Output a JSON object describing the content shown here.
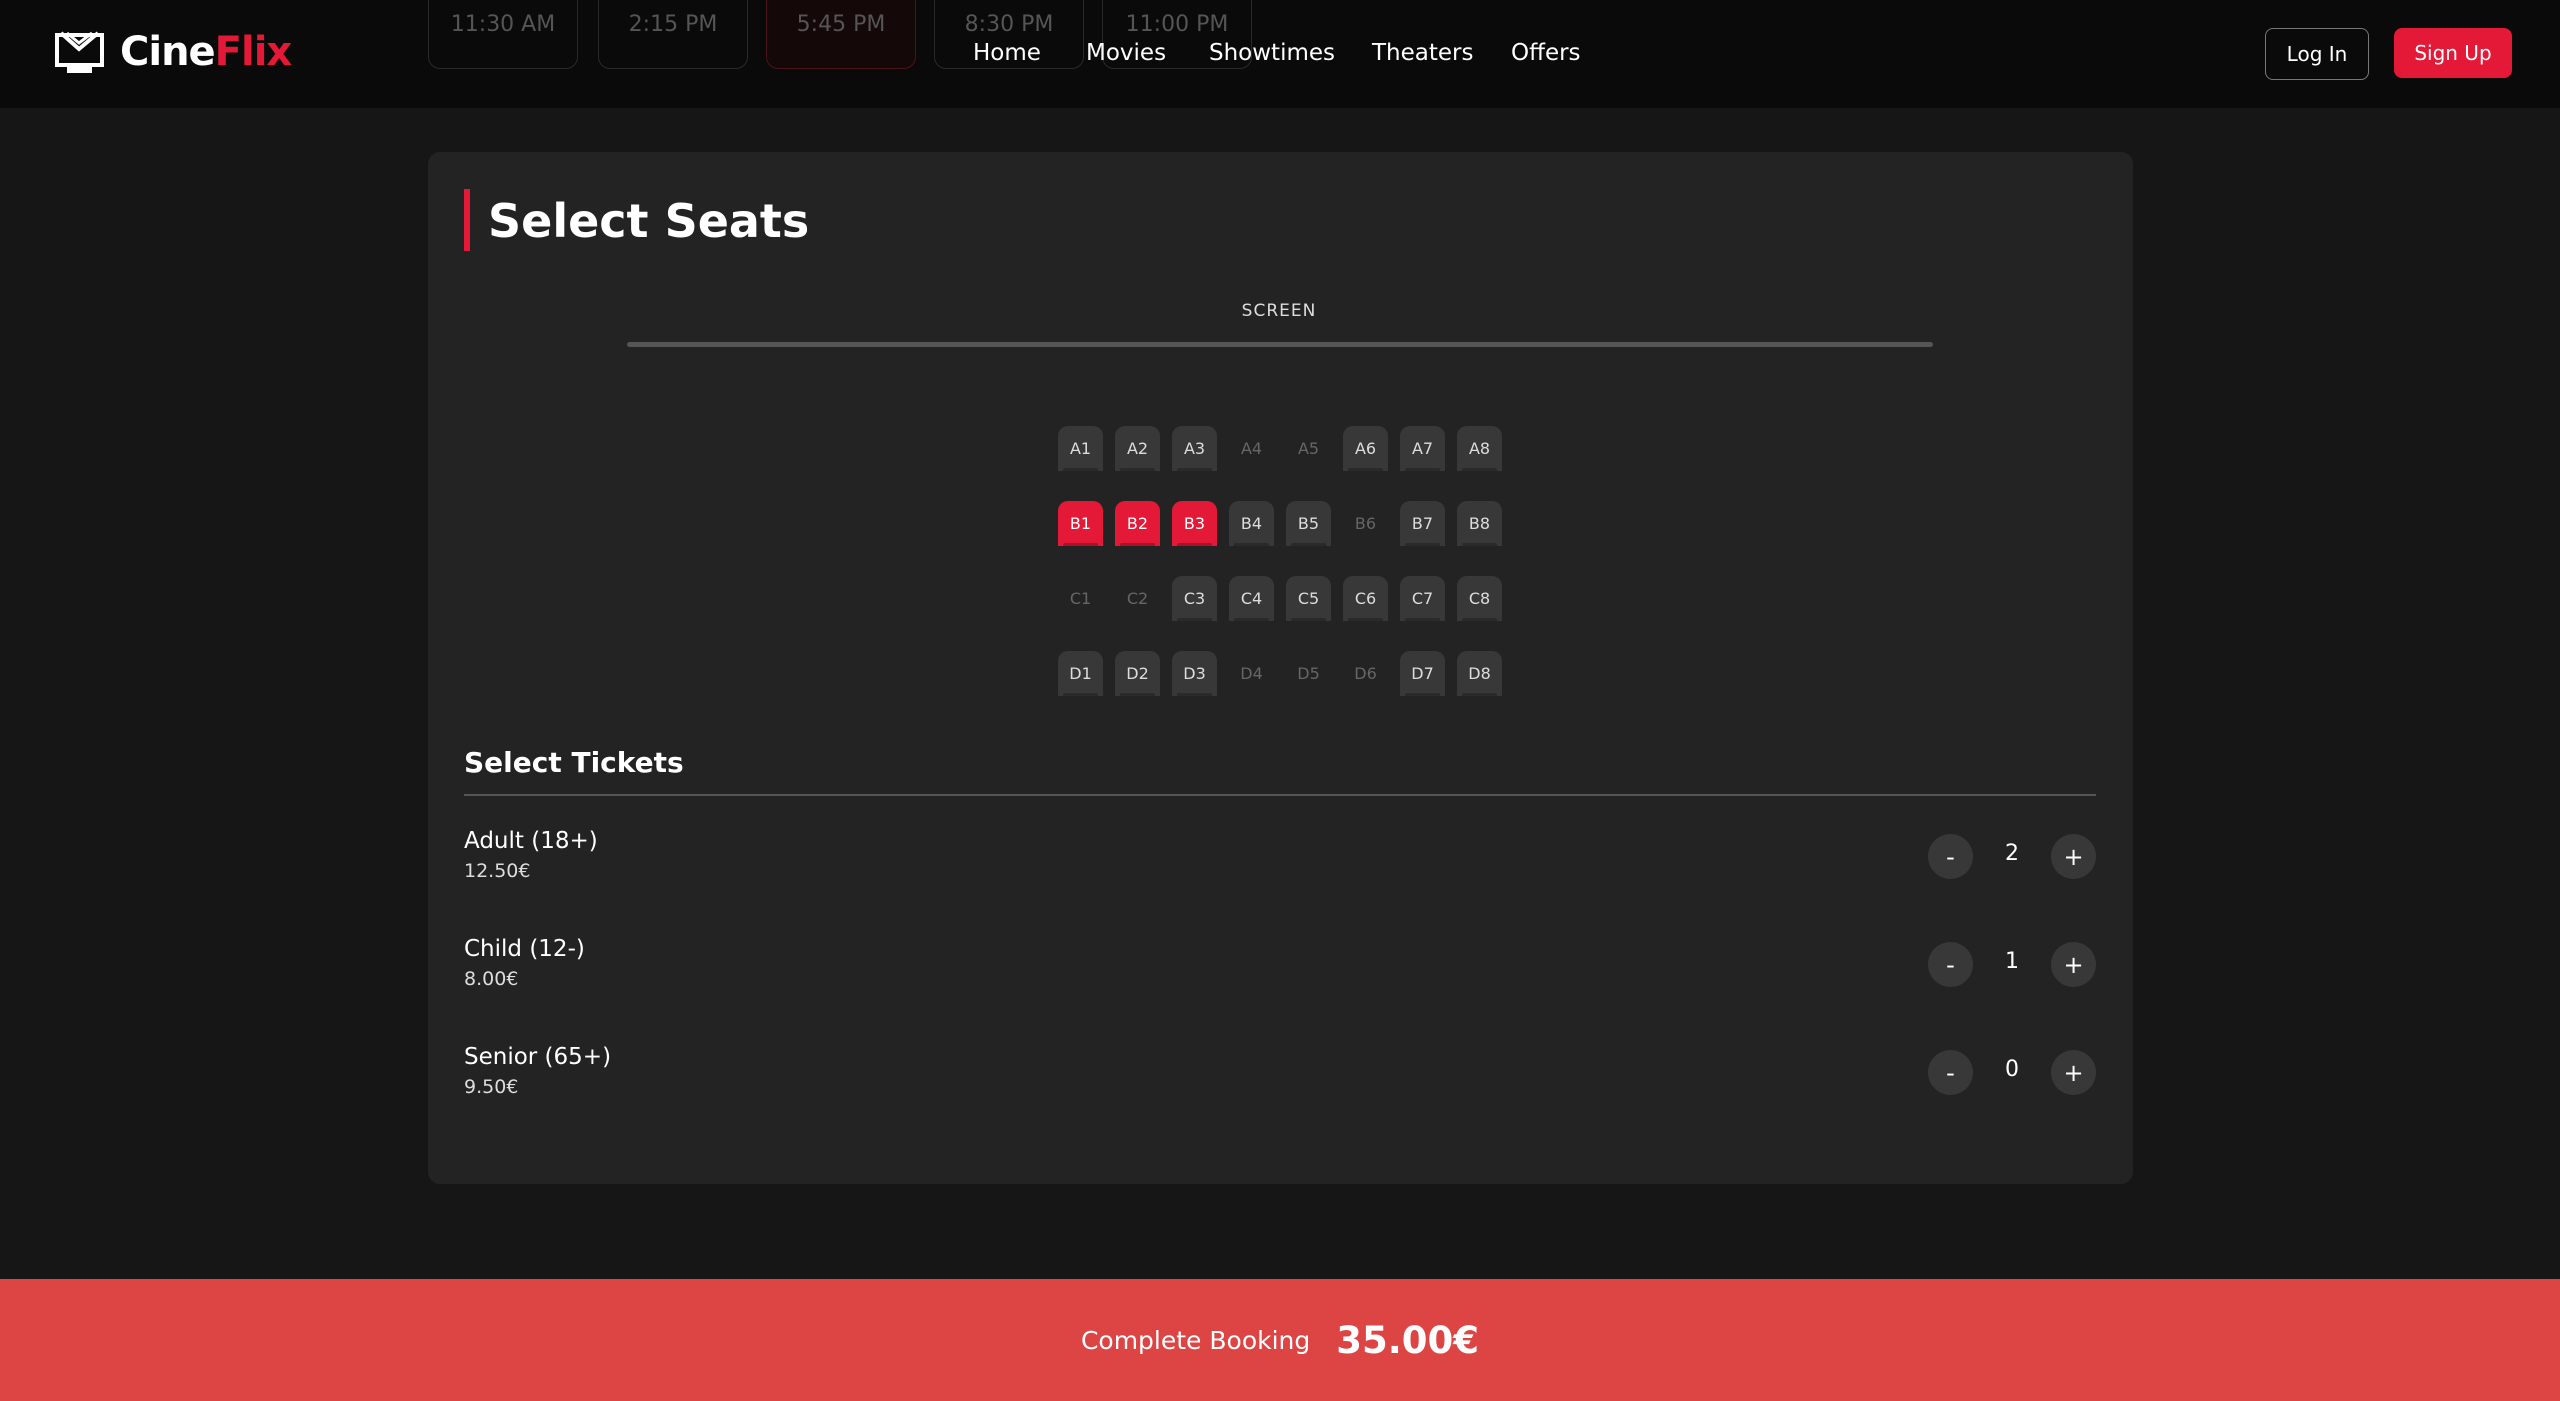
{
  "brand": {
    "name_part1": "Cine",
    "name_part2": "Flix",
    "accent": "#e31937"
  },
  "showtimes": [
    "11:30 AM",
    "2:15 PM",
    "5:45 PM",
    "8:30 PM",
    "11:00 PM"
  ],
  "nav": [
    "Home",
    "Movies",
    "Showtimes",
    "Theaters",
    "Offers"
  ],
  "auth": {
    "login": "Log In",
    "signup": "Sign Up"
  },
  "seats": {
    "title": "Select Seats",
    "screen": "SCREEN",
    "rows": [
      [
        [
          "A1",
          "available"
        ],
        [
          "A2",
          "available"
        ],
        [
          "A3",
          "available"
        ],
        [
          "A4",
          "taken"
        ],
        [
          "A5",
          "taken"
        ],
        [
          "A6",
          "available"
        ],
        [
          "A7",
          "available"
        ],
        [
          "A8",
          "available"
        ]
      ],
      [
        [
          "B1",
          "selected"
        ],
        [
          "B2",
          "selected"
        ],
        [
          "B3",
          "selected"
        ],
        [
          "B4",
          "available"
        ],
        [
          "B5",
          "available"
        ],
        [
          "B6",
          "taken"
        ],
        [
          "B7",
          "available"
        ],
        [
          "B8",
          "available"
        ]
      ],
      [
        [
          "C1",
          "taken"
        ],
        [
          "C2",
          "taken"
        ],
        [
          "C3",
          "available"
        ],
        [
          "C4",
          "available"
        ],
        [
          "C5",
          "available"
        ],
        [
          "C6",
          "available"
        ],
        [
          "C7",
          "available"
        ],
        [
          "C8",
          "available"
        ]
      ],
      [
        [
          "D1",
          "available"
        ],
        [
          "D2",
          "available"
        ],
        [
          "D3",
          "available"
        ],
        [
          "D4",
          "taken"
        ],
        [
          "D5",
          "taken"
        ],
        [
          "D6",
          "taken"
        ],
        [
          "D7",
          "available"
        ],
        [
          "D8",
          "available"
        ]
      ]
    ]
  },
  "tickets": {
    "title": "Select Tickets",
    "items": [
      {
        "label": "Adult (18+)",
        "price": "12.50€",
        "qty": "2"
      },
      {
        "label": "Child (12-)",
        "price": "8.00€",
        "qty": "1"
      },
      {
        "label": "Senior (65+)",
        "price": "9.50€",
        "qty": "0"
      }
    ],
    "minus": "-",
    "plus": "+"
  },
  "footer": {
    "label": "Complete Booking",
    "total": "35.00€"
  }
}
